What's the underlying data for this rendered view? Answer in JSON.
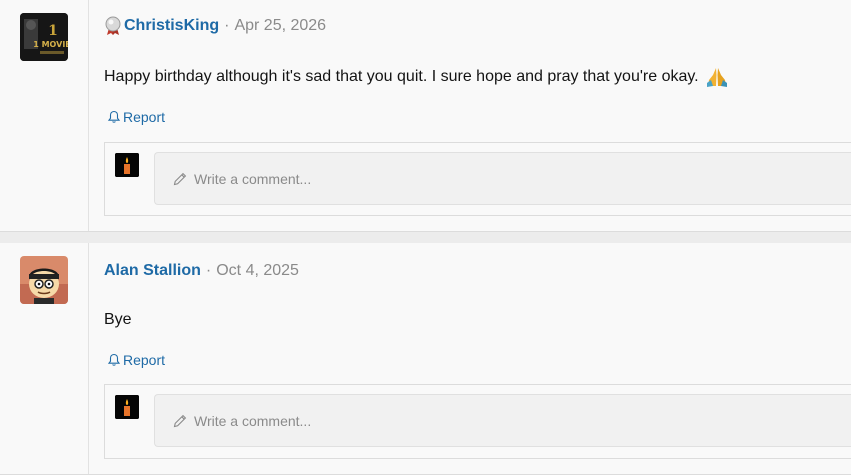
{
  "posts": [
    {
      "username": "ChristisKing",
      "date": "Apr 25, 2026",
      "message": "Happy birthday although it's sad that you quit. I sure hope and pray that you're okay.",
      "emoji": "🙏",
      "report_label": "Report",
      "comment_placeholder": "Write a comment...",
      "has_medal": true,
      "avatar_text": "1 MOVIE"
    },
    {
      "username": "Alan Stallion",
      "date": "Oct 4, 2025",
      "message": "Bye",
      "report_label": "Report",
      "comment_placeholder": "Write a comment...",
      "has_medal": false
    }
  ],
  "separator": "·",
  "colors": {
    "link": "#1e6aa6",
    "muted": "#8a8a8a",
    "background": "#f9f9f9"
  }
}
